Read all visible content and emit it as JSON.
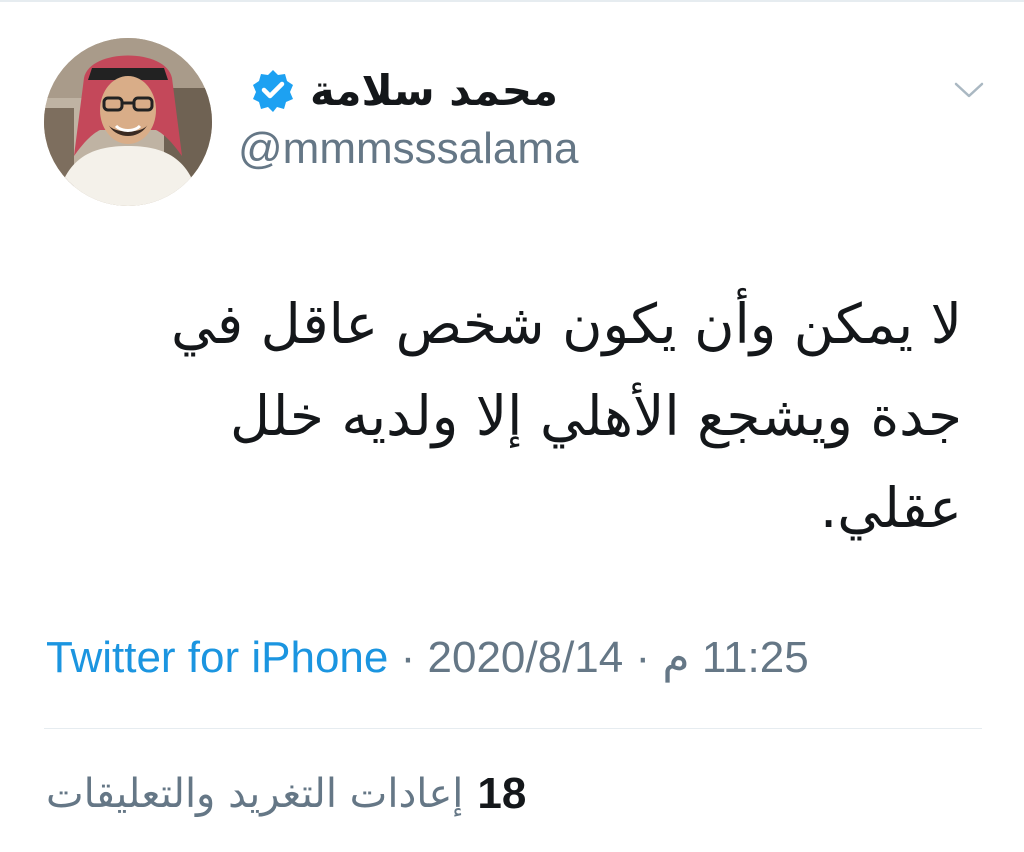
{
  "tweet": {
    "author": {
      "display_name": "محمد سلامة",
      "handle": "@mmmsssalama",
      "verified": true,
      "avatar_icon": "user-avatar-photo"
    },
    "menu_icon": "chevron-down-icon",
    "text_lines": [
      "لا يمكن وأن يكون شخص عاقل في",
      "جدة ويشجع الأهلي إلا ولديه خلل",
      "عقلي."
    ],
    "time": "11:25 م",
    "separator": "·",
    "date": "2020/8/14",
    "source": "Twitter for iPhone",
    "stats": {
      "count": "18",
      "label": "إعادات التغريد والتعليقات"
    }
  },
  "colors": {
    "text": "#14171a",
    "secondary": "#657786",
    "link": "#1b95e0",
    "verified": "#1da1f2",
    "divider": "#e6ecf0"
  }
}
